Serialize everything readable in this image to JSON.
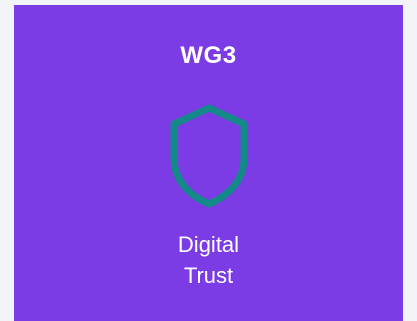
{
  "card": {
    "title": "WG3",
    "label_line1": "Digital",
    "label_line2": "Trust",
    "icon": "shield-icon"
  },
  "colors": {
    "background": "#f3f4f8",
    "card": "#7b3ce6",
    "icon_stroke": "#138a88",
    "text": "#ffffff"
  }
}
